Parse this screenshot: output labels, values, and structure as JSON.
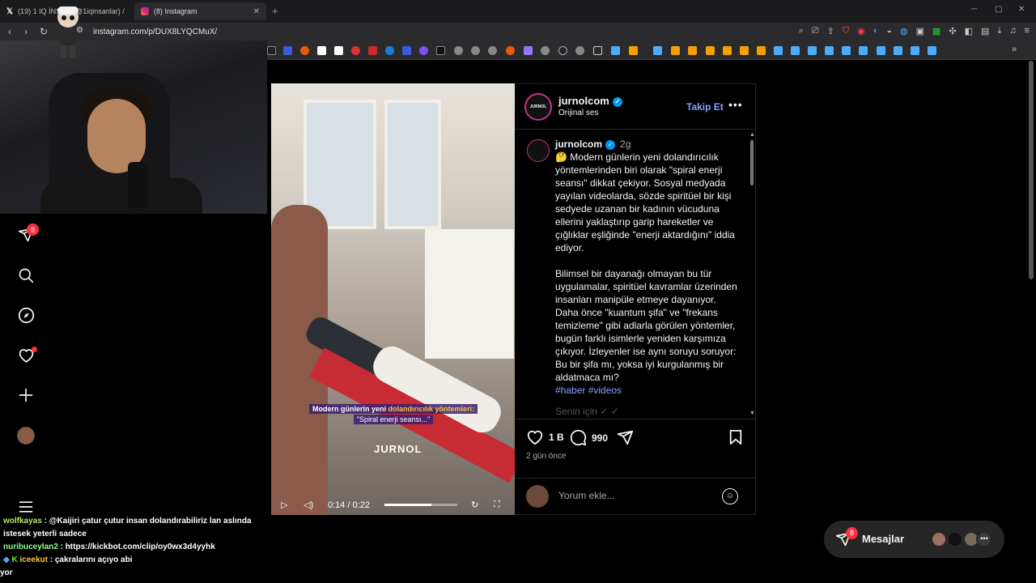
{
  "browser": {
    "tabs": [
      {
        "label": "(19) 1 IQ İNSAN (@1iqinsanlar) /",
        "active": false
      },
      {
        "label": "(8) Instagram",
        "active": true
      }
    ],
    "url": "instagram.com/p/DUX8LYQCMuX/"
  },
  "sidebar": {
    "notification_count": "8"
  },
  "video": {
    "caption_line1_a": "Modern günlerin yeni",
    "caption_line1_b": "dolandırıcılık yöntemleri:",
    "caption_line2": "\"Spiral enerji seansı...\"",
    "watermark": "JURNOL",
    "time": "0:14 / 0:22",
    "progress_fraction": 0.64
  },
  "post": {
    "username": "jurnolcom",
    "audio": "Orijinal ses",
    "follow_label": "Takip Et",
    "caption_age": "2g",
    "paragraph1": "🤔 Modern günlerin yeni dolandırıcılık yöntemlerinden biri olarak \"spiral enerji seansı\" dikkat çekiyor. Sosyal medyada yayılan videolarda, sözde spiritüel bir kişi sedyede uzanan bir kadının vücuduna ellerini yaklaştırıp garip hareketler ve çığlıklar eşliğinde \"enerji aktardığını\" iddia ediyor.",
    "paragraph2": "Bilimsel bir dayanağı olmayan bu tür uygulamalar, spiritüel kavramlar üzerinden insanları manipüle etmeye dayanıyor. Daha önce \"kuantum şifa\" ve \"frekans temizleme\" gibi adlarla görülen yöntemler, bugün farklı isimlerle yeniden karşımıza çıkıyor. İzleyenler ise aynı soruyu soruyor: Bu bir şifa mı, yoksa iyi kurgulanmış bir aldatmaca mı?",
    "hashtags": "#haber #videos",
    "faded_text": "Senin için ✓ ✓",
    "likes": "1 B",
    "comments": "990",
    "posted_ago": "2 gün önce",
    "comment_placeholder": "Yorum ekle..."
  },
  "chat": {
    "messages": [
      {
        "user": "wolfkayas",
        "text": ": @Kaijiri çatur çutur insan dolandırabiliriz lan aslında istesek yeterli sadece"
      },
      {
        "user": "nuribuceylan2",
        "text": ": https://kickbot.com/clip/oy0wx3d4yyhk"
      },
      {
        "user": "iceekut",
        "text": ": çakralarını açıyo abi"
      },
      {
        "user": "",
        "text": "yor"
      }
    ]
  },
  "messages_bar": {
    "label": "Mesajlar",
    "badge": "8"
  }
}
